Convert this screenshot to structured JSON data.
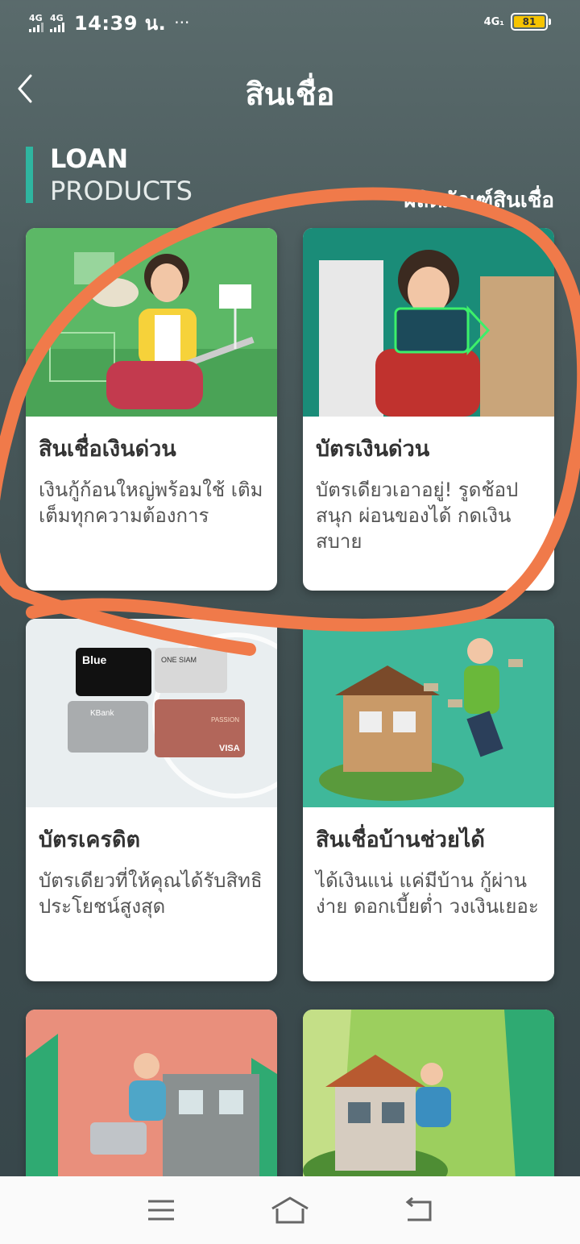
{
  "status_bar": {
    "network_1": "4G",
    "network_2": "4G",
    "time": "14:39 น.",
    "more": "···",
    "network_right": "4G₁",
    "battery": "81"
  },
  "header": {
    "title": "สินเชื่อ",
    "back_icon": "chevron-left-icon"
  },
  "section": {
    "label_line1": "LOAN",
    "label_line2": "PRODUCTS",
    "label_th": "ผลิตภัณฑ์สินเชื่อ",
    "accent_color": "#2fb5a0"
  },
  "cards": [
    {
      "title": "สินเชื่อเงินด่วน",
      "description": "เงินกู้ก้อนใหญ่พร้อมใช้ เติมเต็มทุกความต้องการ",
      "image_bg": "#5cb866"
    },
    {
      "title": "บัตรเงินด่วน",
      "description": "บัตรเดียวเอาอยู่! รูดช้อปสนุก ผ่อนของได้ กดเงินสบาย",
      "image_bg": "#1a8c78"
    },
    {
      "title": "บัตรเครดิต",
      "description": "บัตรเดียวที่ให้คุณได้รับสิทธิประโยชน์สูงสุด",
      "image_bg": "#e9eef0",
      "card_texts": [
        "Blue",
        "ONE SIAM",
        "KBank",
        "PASSION",
        "VISA"
      ]
    },
    {
      "title": "สินเชื่อบ้านช่วยได้",
      "description": "ได้เงินแน่ แค่มีบ้าน กู้ผ่านง่าย ดอกเบี้ยต่ำ วงเงินเยอะ",
      "image_bg": "#3fb89a"
    },
    {
      "title": "",
      "description": "",
      "image_bg": "#e98f7c"
    },
    {
      "title": "",
      "description": "",
      "image_bg": "#9ccf5e"
    }
  ],
  "nav": {
    "menu_icon": "menu-icon",
    "home_icon": "home-icon",
    "back_icon": "back-icon"
  },
  "annotation_color": "#f07a4a"
}
